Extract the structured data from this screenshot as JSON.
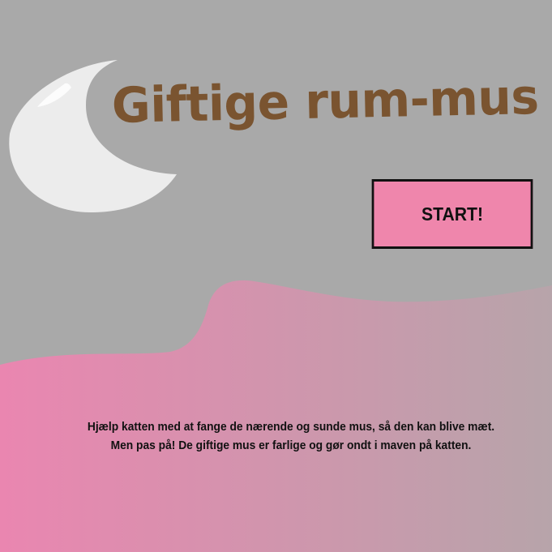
{
  "game": {
    "title": "Giftige rum-mus",
    "start_label": "START!",
    "intro_lines": [
      "Hjælp katten med at fange de nærende og sunde mus, så den kan blive mæt.",
      "Men pas på! De giftige mus er farlige og gør ondt i maven på katten."
    ]
  },
  "colors": {
    "background": "#a9a9a9",
    "title": "#7a5430",
    "button_fill": "#ef86ac",
    "button_border": "#111111",
    "moon": "#ececec",
    "wave_left": "#ea86b0",
    "wave_right": "#b7a4aa"
  },
  "icons": {
    "moon": "crescent-moon-icon"
  }
}
